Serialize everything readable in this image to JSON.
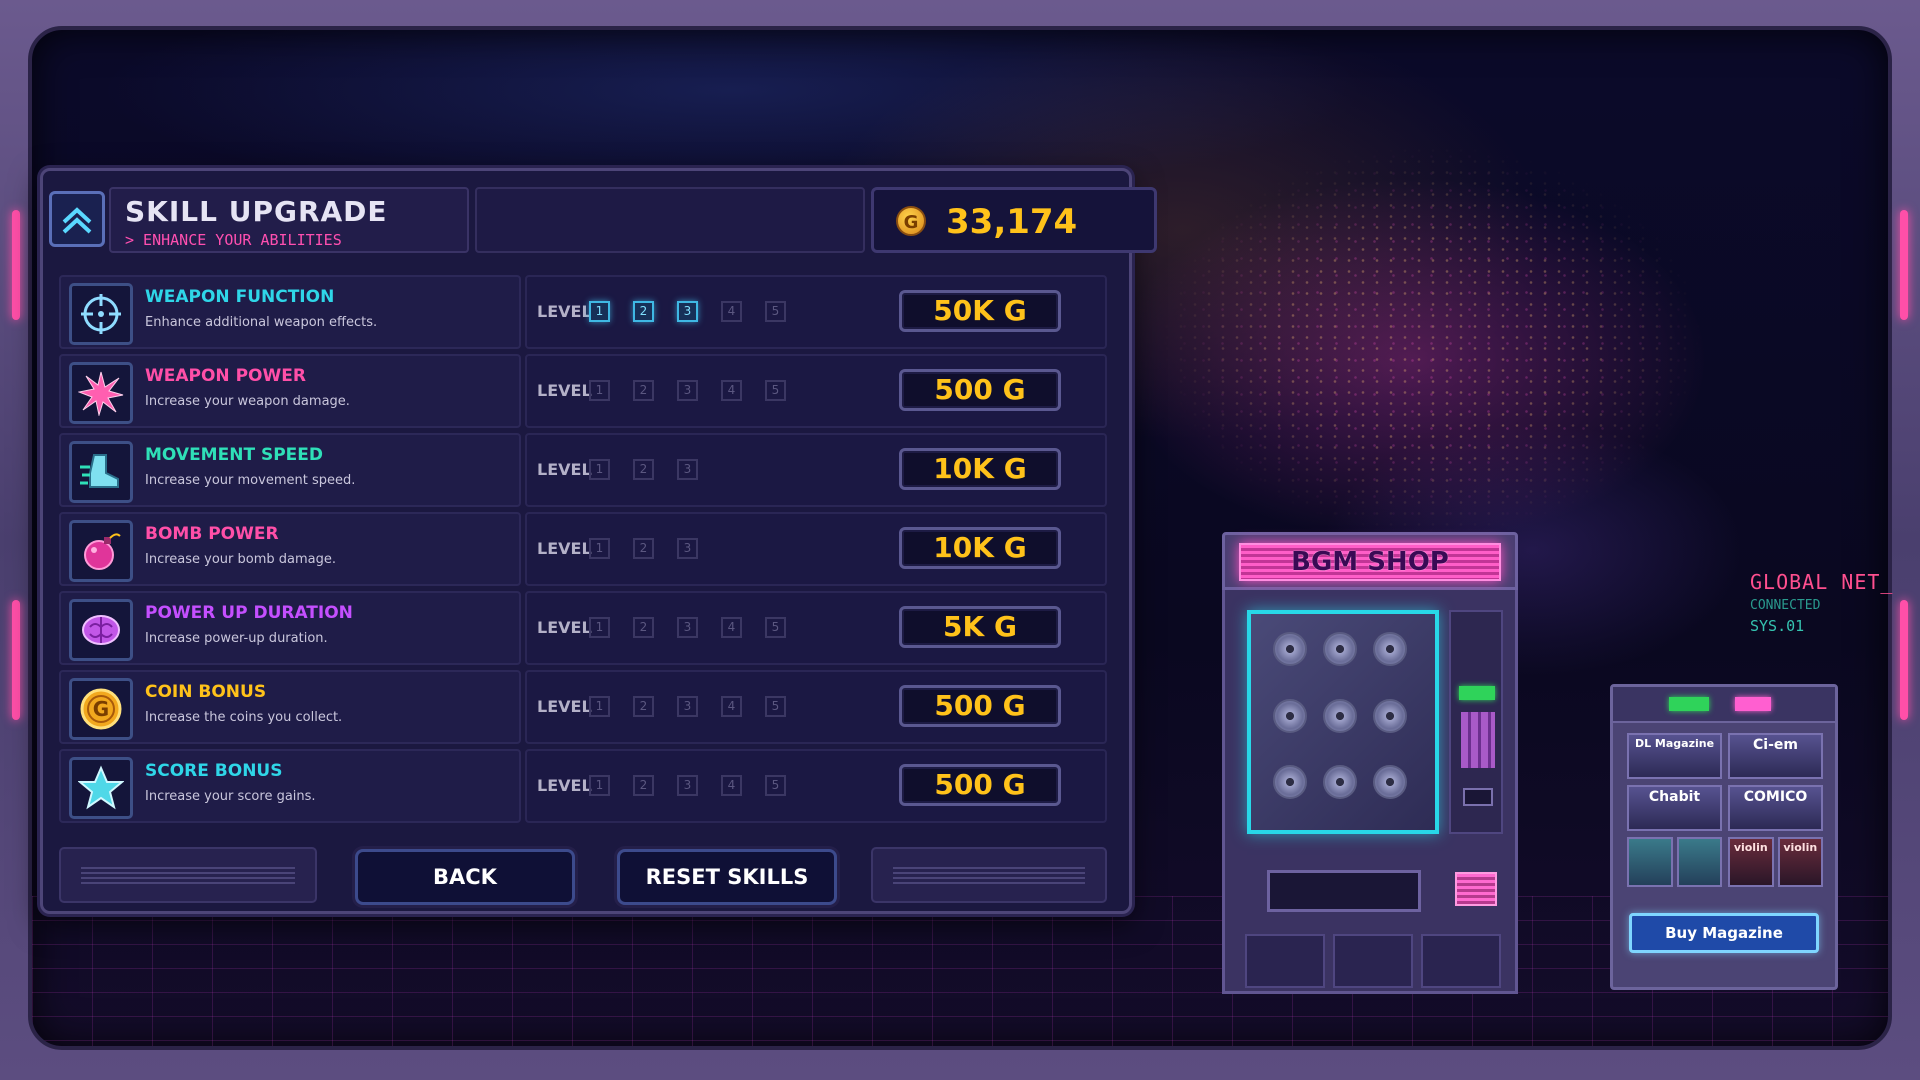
{
  "header": {
    "title": "SKILL UPGRADE",
    "subtitle": "> ENHANCE YOUR ABILITIES",
    "coins": "33,174",
    "coin_symbol": "G"
  },
  "level_label": "LEVEL",
  "skills": [
    {
      "name": "WEAPON FUNCTION",
      "desc": "Enhance additional weapon effects.",
      "color": "#2fd6e8",
      "icon": "crosshair-icon",
      "levels": [
        "1",
        "2",
        "3",
        "4",
        "5"
      ],
      "owned": 3,
      "price": "50K G"
    },
    {
      "name": "WEAPON POWER",
      "desc": "Increase your weapon damage.",
      "color": "#ff4fa8",
      "icon": "burst-icon",
      "levels": [
        "1",
        "2",
        "3",
        "4",
        "5"
      ],
      "owned": 0,
      "price": "500 G"
    },
    {
      "name": "MOVEMENT SPEED",
      "desc": "Increase your movement speed.",
      "color": "#2fe0b8",
      "icon": "boot-icon",
      "levels": [
        "1",
        "2",
        "3"
      ],
      "owned": 0,
      "price": "10K G"
    },
    {
      "name": "BOMB POWER",
      "desc": "Increase your bomb damage.",
      "color": "#ff4fa8",
      "icon": "bomb-icon",
      "levels": [
        "1",
        "2",
        "3"
      ],
      "owned": 0,
      "price": "10K G"
    },
    {
      "name": "POWER UP DURATION",
      "desc": "Increase power-up duration.",
      "color": "#c44fff",
      "icon": "brain-icon",
      "levels": [
        "1",
        "2",
        "3",
        "4",
        "5"
      ],
      "owned": 0,
      "price": "5K G"
    },
    {
      "name": "COIN BONUS",
      "desc": "Increase the coins you collect.",
      "color": "#ffc21a",
      "icon": "coin-icon",
      "levels": [
        "1",
        "2",
        "3",
        "4",
        "5"
      ],
      "owned": 0,
      "price": "500 G"
    },
    {
      "name": "SCORE BONUS",
      "desc": "Increase your score gains.",
      "color": "#2fd6e8",
      "icon": "star-icon",
      "levels": [
        "1",
        "2",
        "3",
        "4",
        "5"
      ],
      "owned": 0,
      "price": "500 G"
    }
  ],
  "footer": {
    "back_label": "BACK",
    "reset_label": "RESET SKILLS"
  },
  "bgm_shop": {
    "title": "BGM SHOP"
  },
  "magazine": {
    "items": [
      "DL Magazine",
      "Ci-em",
      "Chabit",
      "COMICO",
      "violin",
      "violin"
    ],
    "buy_label": "Buy Magazine"
  },
  "global_net": {
    "line1": "GLOBAL NET_",
    "line2": "CONNECTED",
    "line3": "SYS.01"
  }
}
